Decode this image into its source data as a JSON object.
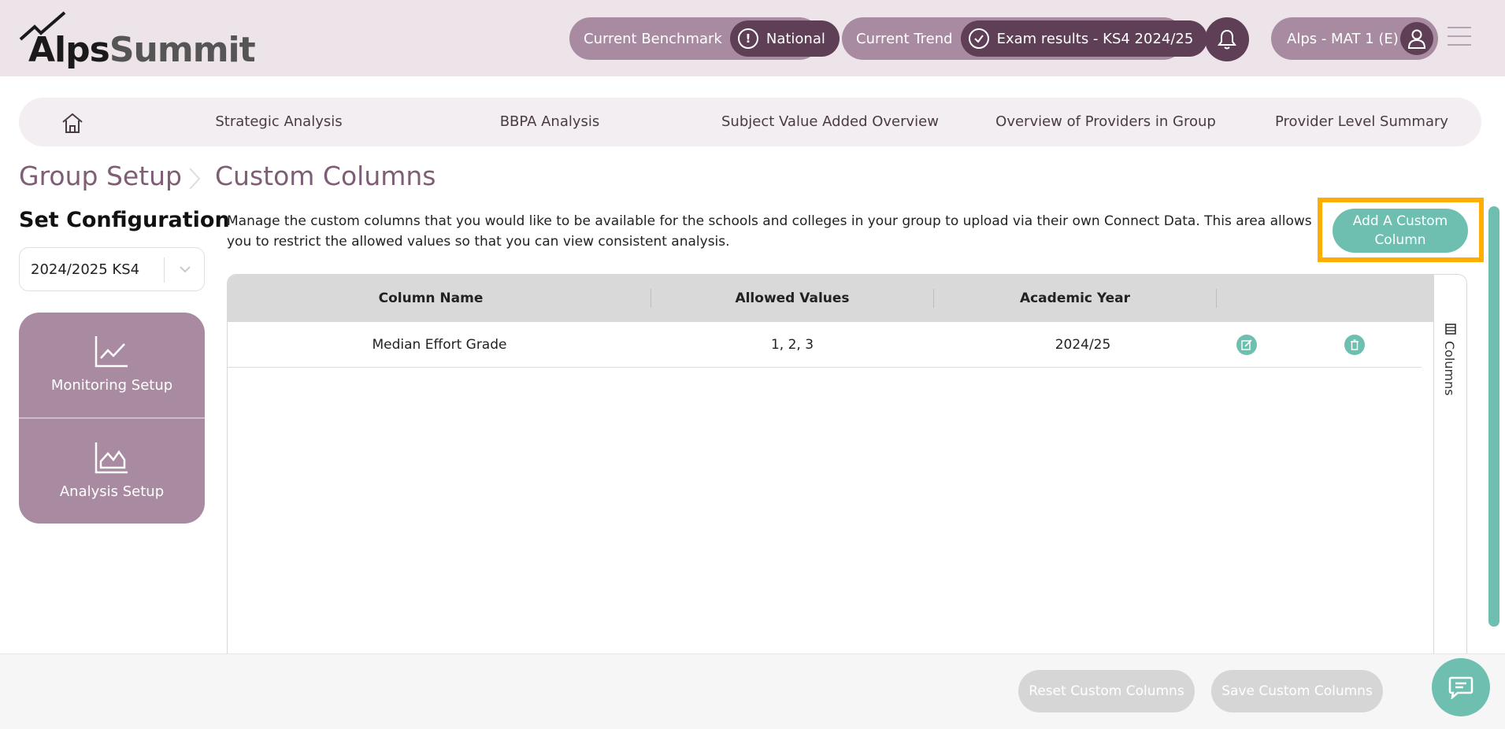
{
  "brand": {
    "name_part1": "Alps",
    "name_part2": "Summit"
  },
  "header": {
    "benchmark_label": "Current Benchmark",
    "benchmark_value": "National",
    "trend_label": "Current Trend",
    "trend_value": "Exam results - KS4 2024/25",
    "user_label": "Alps - MAT 1 (E)"
  },
  "nav": {
    "items": [
      {
        "label": "Strategic Analysis"
      },
      {
        "label": "BBPA Analysis"
      },
      {
        "label": "Subject Value Added Overview"
      },
      {
        "label": "Overview of Providers in Group"
      },
      {
        "label": "Provider Level Summary"
      }
    ]
  },
  "breadcrumb": {
    "parent": "Group Setup",
    "current": "Custom Columns"
  },
  "sidebar": {
    "title": "Set Configuration",
    "year_selected": "2024/2025 KS4",
    "menu": [
      {
        "label": "Monitoring Setup",
        "icon": "line-chart-icon"
      },
      {
        "label": "Analysis Setup",
        "icon": "area-chart-icon"
      }
    ]
  },
  "main": {
    "description": "Manage the custom columns that you would like to be available for the schools and colleges in your group to upload via their own Connect Data. This area allows you to restrict the allowed values so that you can view consistent analysis.",
    "add_button": "Add A Custom Column",
    "table": {
      "columns": [
        "Column Name",
        "Allowed Values",
        "Academic Year"
      ],
      "rows": [
        {
          "name": "Median Effort Grade",
          "values": "1, 2, 3",
          "year": "2024/25"
        }
      ],
      "side_panel_label": "Columns"
    }
  },
  "footer": {
    "reset_label": "Reset Custom Columns",
    "save_label": "Save Custom Columns"
  },
  "colors": {
    "header_bg": "#ede4ea",
    "pill": "#a98ba1",
    "pill_dark": "#5e3f55",
    "accent_teal": "#6fbfb1",
    "highlight": "#ffad00",
    "breadcrumb": "#7e5d75"
  }
}
